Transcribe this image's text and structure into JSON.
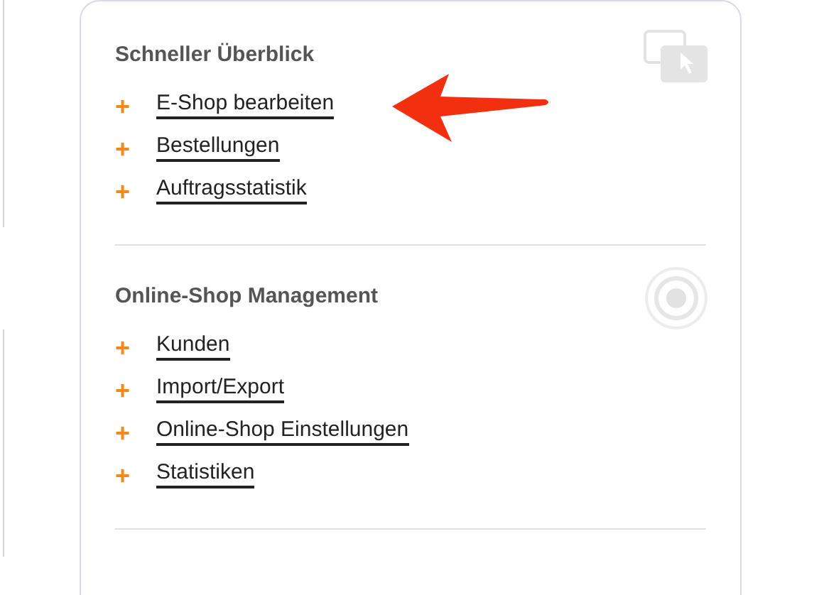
{
  "sections": [
    {
      "title": "Schneller Überblick",
      "links": [
        {
          "marker": "+",
          "label": "E-Shop bearbeiten"
        },
        {
          "marker": "+",
          "label": "Bestellungen"
        },
        {
          "marker": "+",
          "label": "Auftragsstatistik"
        }
      ]
    },
    {
      "title": "Online-Shop Management",
      "links": [
        {
          "marker": "+",
          "label": "Kunden"
        },
        {
          "marker": "+",
          "label": "Import/Export"
        },
        {
          "marker": "+",
          "label": "Online-Shop Einstellungen"
        },
        {
          "marker": "+",
          "label": "Statistiken"
        }
      ]
    }
  ]
}
